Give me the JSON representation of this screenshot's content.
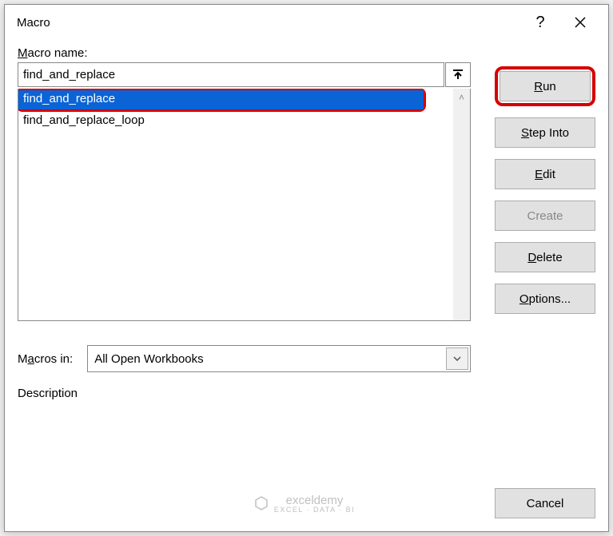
{
  "titlebar": {
    "title": "Macro",
    "help": "?",
    "close": "×"
  },
  "labels": {
    "macro_name": "Macro name:",
    "macros_in": "Macros in:",
    "description": "Description"
  },
  "name_input": {
    "value": "find_and_replace"
  },
  "macro_list": {
    "items": [
      {
        "label": "find_and_replace",
        "selected": true
      },
      {
        "label": "find_and_replace_loop",
        "selected": false
      }
    ]
  },
  "macros_in_select": {
    "value": "All Open Workbooks"
  },
  "buttons": {
    "run": "Run",
    "step_into": "Step Into",
    "edit": "Edit",
    "create": "Create",
    "delete": "Delete",
    "options": "Options...",
    "cancel": "Cancel"
  },
  "watermark": {
    "name": "exceldemy",
    "sub": "EXCEL · DATA · BI"
  }
}
